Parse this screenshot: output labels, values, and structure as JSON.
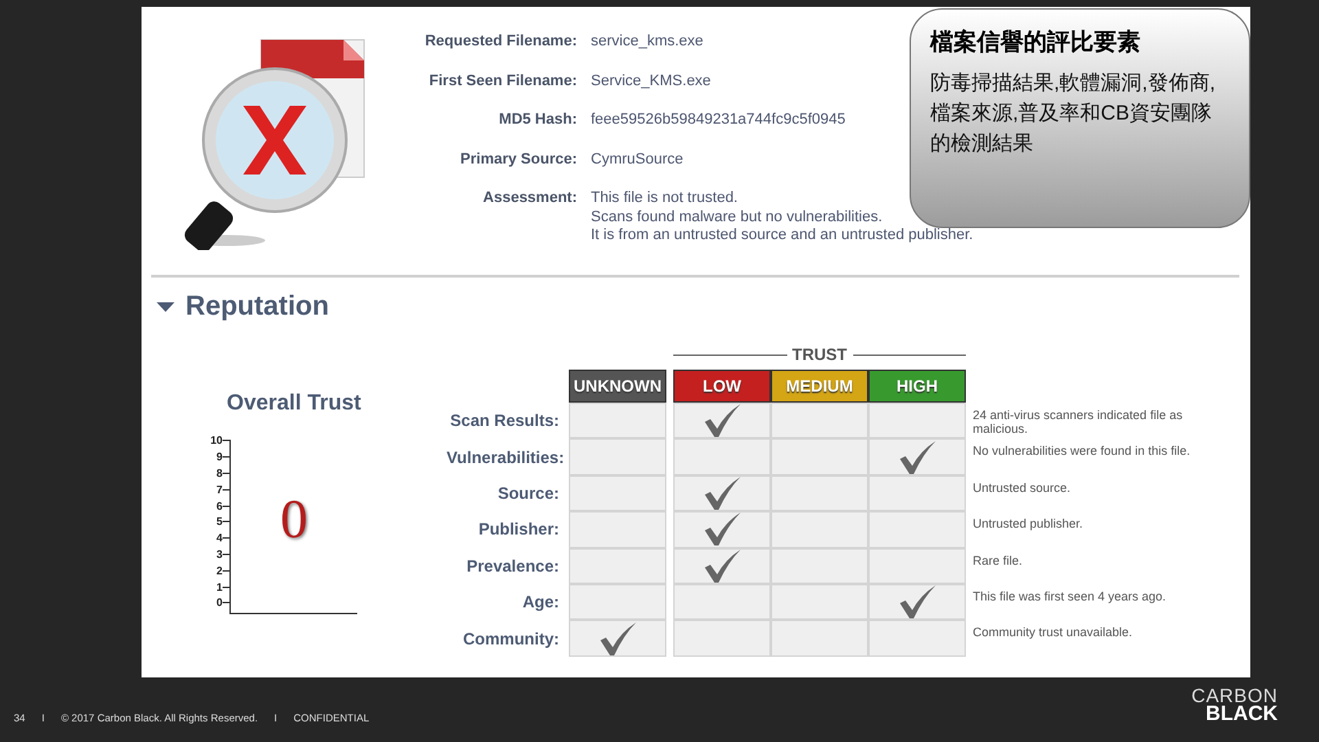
{
  "file_info": [
    {
      "label": "Requested Filename:",
      "value": "service_kms.exe"
    },
    {
      "label": "First Seen Filename:",
      "value": "Service_KMS.exe"
    },
    {
      "label": "MD5 Hash:",
      "value": "feee59526b59849231a744fc9c5f0945"
    },
    {
      "label": "Primary Source:",
      "value": "CymruSource"
    },
    {
      "label": "Assessment:",
      "lines": [
        "This file is not trusted.",
        "Scans found malware but no vulnerabilities.",
        "It is from an untrusted source and an untrusted publisher."
      ]
    }
  ],
  "callout": {
    "title": "檔案信譽的評比要素",
    "body": "防毒掃描結果,軟體漏洞,發佈商,檔案來源,普及率和CB資安團隊的檢測結果"
  },
  "reputation": {
    "title": "Reputation",
    "expanded": true,
    "overall": {
      "title": "Overall Trust",
      "ticks": [
        "10",
        "9",
        "8",
        "7",
        "6",
        "5",
        "4",
        "3",
        "2",
        "1",
        "0"
      ],
      "score": "0"
    },
    "trust_label": "TRUST",
    "columns": [
      {
        "label": "UNKNOWN",
        "color": "#555555"
      },
      {
        "label": "LOW",
        "color": "#c42020"
      },
      {
        "label": "MEDIUM",
        "color": "#d4a514"
      },
      {
        "label": "HIGH",
        "color": "#389a2e"
      }
    ],
    "rows": [
      {
        "label": "Scan Results:",
        "checks": [
          false,
          true,
          false,
          false
        ],
        "description": "24 anti-virus scanners indicated file as malicious."
      },
      {
        "label": "Vulnerabilities:",
        "checks": [
          false,
          false,
          false,
          true
        ],
        "description": "No vulnerabilities were found in this file."
      },
      {
        "label": "Source:",
        "checks": [
          false,
          true,
          false,
          false
        ],
        "description": "Untrusted source."
      },
      {
        "label": "Publisher:",
        "checks": [
          false,
          true,
          false,
          false
        ],
        "description": "Untrusted publisher."
      },
      {
        "label": "Prevalence:",
        "checks": [
          false,
          true,
          false,
          false
        ],
        "description": "Rare file."
      },
      {
        "label": "Age:",
        "checks": [
          false,
          false,
          false,
          true
        ],
        "description": "This file was first seen 4 years ago."
      },
      {
        "label": "Community:",
        "checks": [
          true,
          false,
          false,
          false
        ],
        "description": "Community trust unavailable."
      }
    ]
  },
  "footer": [
    "34",
    "I",
    "© 2017 Carbon Black. All Rights Reserved.",
    "I",
    "CONFIDENTIAL"
  ],
  "logo": [
    "CARBON",
    "BLACK"
  ]
}
